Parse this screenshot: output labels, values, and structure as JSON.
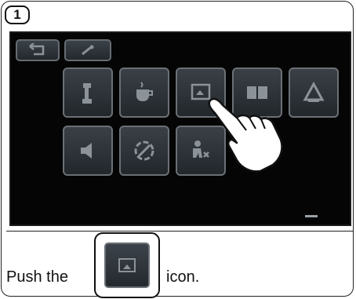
{
  "step": {
    "number": "1"
  },
  "instruction": {
    "before": "Push the",
    "after": "icon."
  },
  "icons": {
    "top_row": [
      "back-icon",
      "tool-icon"
    ],
    "row1": [
      "phone-icon",
      "coffee-icon",
      "picture-frame-icon",
      "book-icon",
      "alarm-icon"
    ],
    "row2": [
      "speaker-icon",
      "no-disturb-icon",
      "person-icon"
    ],
    "target": "picture-frame-icon"
  },
  "colors": {
    "tile_border": "#6a7075",
    "screen_bg": "#050505",
    "icon_gray": "#8b9298"
  }
}
